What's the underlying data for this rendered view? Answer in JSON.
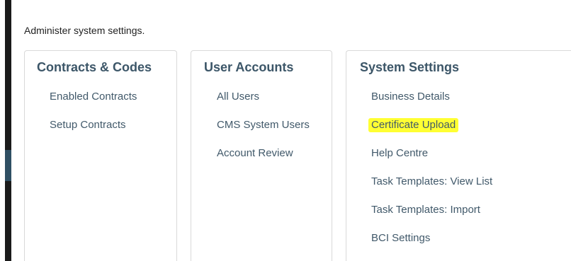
{
  "intro": "Administer system settings.",
  "cards": [
    {
      "title": "Contracts & Codes",
      "links": [
        "Enabled Contracts",
        "Setup Contracts"
      ]
    },
    {
      "title": "User Accounts",
      "links": [
        "All Users",
        "CMS System Users",
        "Account Review"
      ]
    },
    {
      "title": "System Settings",
      "links": [
        "Business Details",
        "Certificate Upload",
        "Help Centre",
        "Task Templates: View List",
        "Task Templates: Import",
        "BCI Settings"
      ]
    }
  ],
  "colors": {
    "heading": "#3c5668",
    "link": "#41596a",
    "highlight": "#ffff33",
    "border": "#d9d9d9",
    "left_bar": "#1b1b1b"
  }
}
